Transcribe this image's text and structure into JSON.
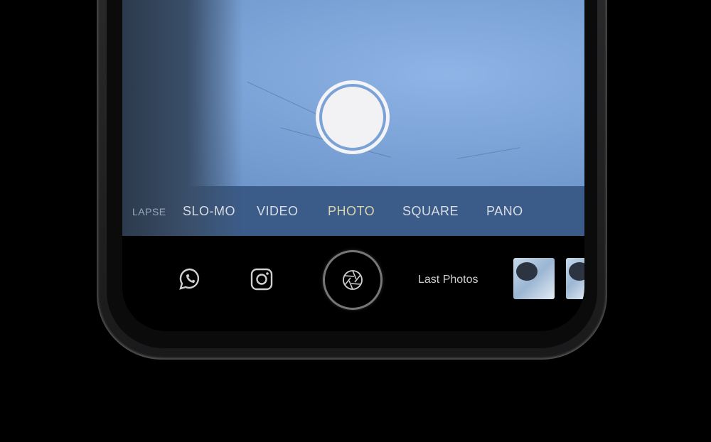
{
  "camera": {
    "modes": [
      {
        "label": "LAPSE",
        "active": false
      },
      {
        "label": "SLO-MO",
        "active": false
      },
      {
        "label": "VIDEO",
        "active": false
      },
      {
        "label": "PHOTO",
        "active": true
      },
      {
        "label": "SQUARE",
        "active": false
      },
      {
        "label": "PANO",
        "active": false
      }
    ],
    "bottom_bar": {
      "share_icons": [
        "whatsapp-icon",
        "instagram-icon"
      ],
      "shutter_icon": "aperture-icon",
      "last_photos_label": "Last Photos"
    }
  },
  "colors": {
    "mode_bar": "#3b5c89",
    "active_mode": "#d9d4ad",
    "preview": "#7ba2d6"
  }
}
